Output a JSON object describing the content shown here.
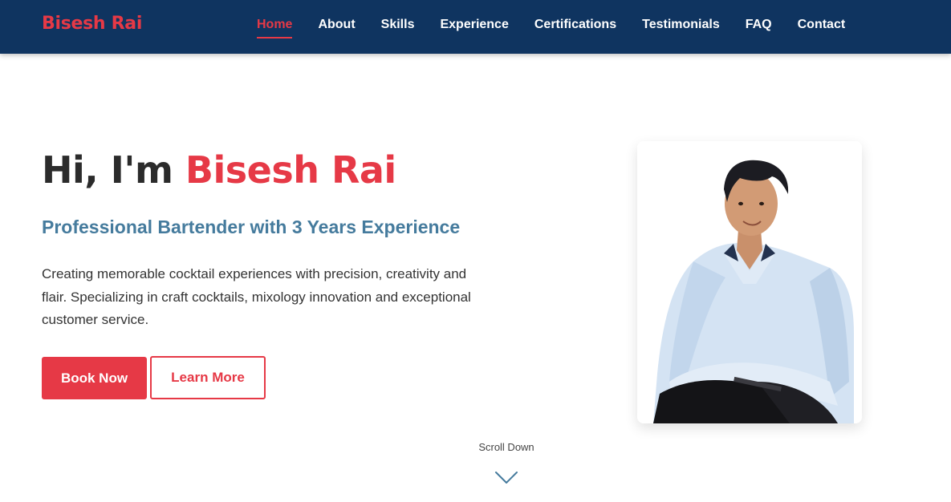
{
  "nav": {
    "brand": "Bisesh Rai",
    "links": [
      {
        "label": "Home",
        "active": true
      },
      {
        "label": "About"
      },
      {
        "label": "Skills"
      },
      {
        "label": "Experience"
      },
      {
        "label": "Certifications"
      },
      {
        "label": "Testimonials"
      },
      {
        "label": "FAQ"
      },
      {
        "label": "Contact"
      }
    ]
  },
  "hero": {
    "greeting": "Hi, I'm",
    "name": "Bisesh Rai",
    "subtitle": "Professional Bartender with 3 Years Experience",
    "description": "Creating memorable cocktail experiences with precision, creativity and flair. Specializing in craft cocktails, mixology innovation and exceptional customer service.",
    "primary_button": "Book Now",
    "secondary_button": "Learn More",
    "profile_icon": "person-photo"
  },
  "scroll": {
    "label": "Scroll Down",
    "icon": "chevron-down-icon"
  },
  "colors": {
    "nav_bg": "#0f3460",
    "accent": "#e63946",
    "subtitle": "#457b9d"
  }
}
